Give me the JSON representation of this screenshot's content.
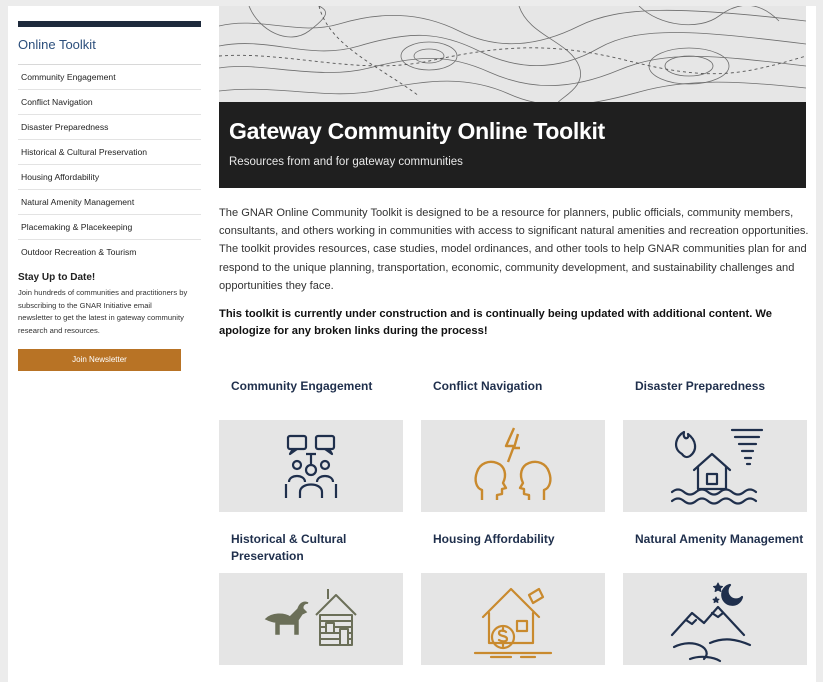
{
  "sidebar": {
    "title": "Online Toolkit",
    "items": [
      "Community Engagement",
      "Conflict Navigation",
      "Disaster Preparedness",
      "Historical & Cultural Preservation",
      "Housing Affordability",
      "Natural Amenity Management",
      "Placemaking & Placekeeping",
      "Outdoor Recreation & Tourism"
    ],
    "stay_title": "Stay Up to Date!",
    "stay_text": "Join hundreds of communities and practitioners by subscribing to the GNAR Initiative email newsletter to get the latest in gateway community research and resources.",
    "join_label": "Join Newsletter"
  },
  "hero": {
    "title": "Gateway Community Online Toolkit",
    "subtitle": "Resources from and for gateway communities"
  },
  "intro": "The GNAR Online Community Toolkit is designed to be a resource for planners, public officials, community members, consultants, and others working in communities with access to significant natural amenities and recreation opportunities.  The toolkit provides resources, case studies, model ordinances, and other tools to help GNAR communities plan for and respond to the unique planning, transportation, economic, community development, and sustainability challenges and opportunities they face.",
  "notice": "This toolkit is currently under construction and is continually being updated with additional content. We apologize for any broken links during the process!",
  "cards": [
    {
      "title": "Community Engagement",
      "icon": "people-network-icon"
    },
    {
      "title": "Conflict Navigation",
      "icon": "conflict-heads-icon"
    },
    {
      "title": "Disaster Preparedness",
      "icon": "disaster-house-icon"
    },
    {
      "title": "Historical & Cultural Preservation",
      "icon": "goat-cabin-icon"
    },
    {
      "title": "Housing Affordability",
      "icon": "house-money-icon"
    },
    {
      "title": "Natural Amenity Management",
      "icon": "mountain-moon-icon"
    }
  ],
  "colors": {
    "accent": "#b87325",
    "navy": "#1f2f4c",
    "hero_band": "#1f1f1f",
    "icon_gold": "#c98a2e"
  }
}
